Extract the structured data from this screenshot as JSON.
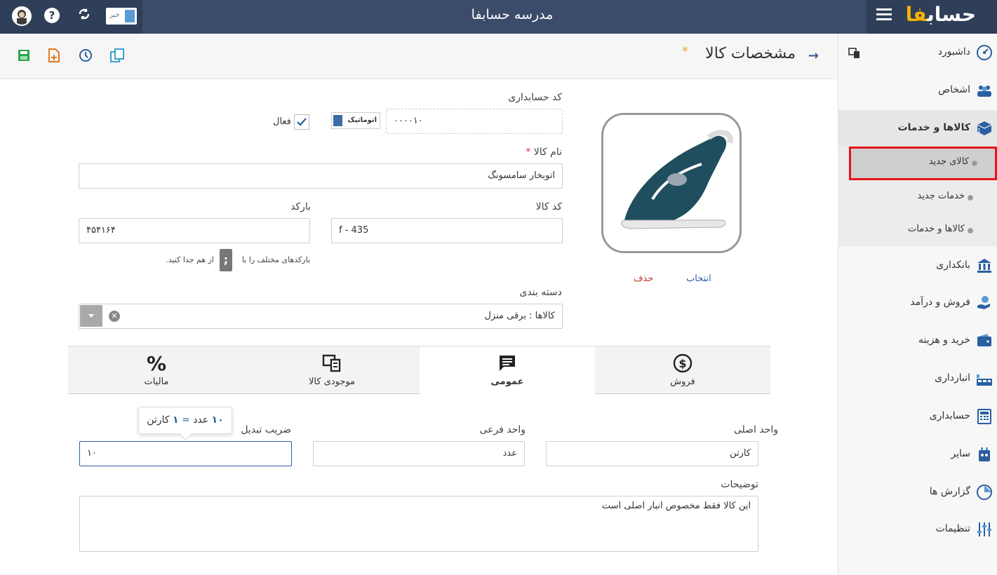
{
  "topbar": {
    "title": "مدرسه حسابفا",
    "toggle_label": "خیر",
    "logo_main": "حساب",
    "logo_accent": "فا"
  },
  "sidebar": {
    "items": [
      {
        "label": "داشبورد",
        "icon": "dashboard-icon"
      },
      {
        "label": "اشخاص",
        "icon": "people-icon"
      },
      {
        "label": "کالاها و خدمات",
        "icon": "box-icon"
      },
      {
        "label": "بانکداری",
        "icon": "bank-icon"
      },
      {
        "label": "فروش و درآمد",
        "icon": "sales-icon"
      },
      {
        "label": "خرید و هزینه",
        "icon": "wallet-icon"
      },
      {
        "label": "انبارداری",
        "icon": "warehouse-icon"
      },
      {
        "label": "حسابداری",
        "icon": "calculator-icon"
      },
      {
        "label": "سایر",
        "icon": "other-icon"
      },
      {
        "label": "گزارش ها",
        "icon": "report-icon"
      },
      {
        "label": "تنظیمات",
        "icon": "settings-icon"
      }
    ],
    "subitems": [
      {
        "label": "کالای جدید"
      },
      {
        "label": "خدمات جدید"
      },
      {
        "label": "کالاها و خدمات"
      }
    ]
  },
  "header": {
    "title": "مشخصات کالا",
    "star": "*"
  },
  "form": {
    "accounting_code_label": "کد حسابداری",
    "accounting_code_value": "۰۰۰۰۱۰",
    "auto_label": "اتوماتیک",
    "active_label": "فعال",
    "name_label": "نام کالا",
    "name_required": "*",
    "name_value": "اتوبخار سامسونگ",
    "product_code_label": "کد کالا",
    "product_code_value": "f - 435",
    "barcode_label": "بارکد",
    "barcode_value": "۴۵۴۱۶۴",
    "barcode_hint_a": "بارکدهای مختلف را با",
    "barcode_separator": ";",
    "barcode_hint_b": "از هم جدا کنید.",
    "category_label": "دسته بندی",
    "category_value": "کالاها : برقی منزل",
    "image_select": "انتخاب",
    "image_delete": "حذف"
  },
  "tabs": [
    {
      "label": "فروش",
      "icon": "dollar-icon"
    },
    {
      "label": "عمومی",
      "icon": "message-icon"
    },
    {
      "label": "موجودی کالا",
      "icon": "inventory-icon"
    },
    {
      "label": "مالیات",
      "icon": "percent-icon"
    }
  ],
  "units": {
    "main_label": "واحد اصلی",
    "main_value": "کارتن",
    "sub_label": "واحد فرعی",
    "sub_value": "عدد",
    "factor_label": "ضریب تبدیل",
    "factor_value": "۱۰"
  },
  "tooltip": {
    "qty_a": "۱۰",
    "unit_a": "عدد",
    "equals": "=",
    "qty_b": "۱",
    "unit_b": "کارتن"
  },
  "description": {
    "label": "توضیحات",
    "value": "این کالا فقط مخصوص انبار اصلی است"
  },
  "colors": {
    "topbar": "#3b4c6b",
    "accent": "#3a6ea5",
    "highlight": "#e8121a",
    "delete": "#c0392b",
    "select": "#2a5fa0"
  }
}
